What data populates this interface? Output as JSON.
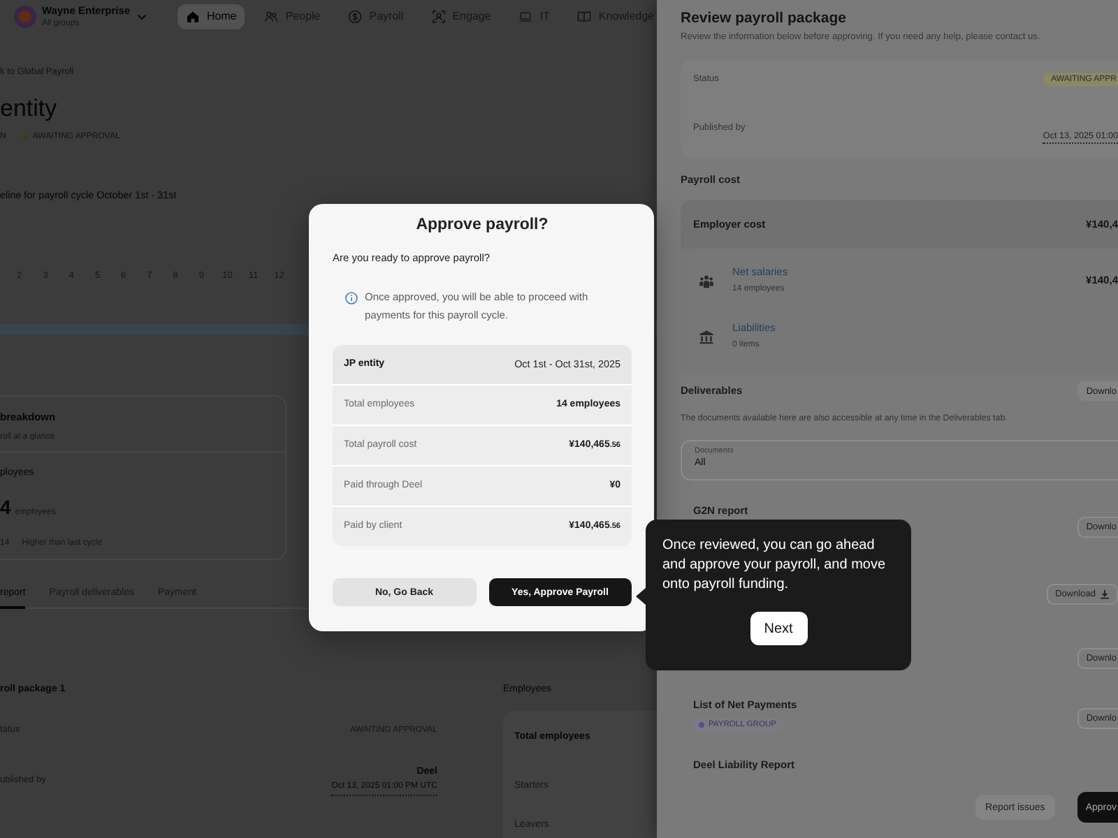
{
  "background_page": {
    "organization": {
      "name": "Wayne Enterprise",
      "subtitle": "All groups"
    },
    "nav": [
      {
        "label": "Home",
        "selected": true
      },
      {
        "label": "People",
        "selected": false
      },
      {
        "label": "Payroll",
        "selected": false
      },
      {
        "label": "Engage",
        "selected": false
      },
      {
        "label": "IT",
        "selected": false
      },
      {
        "label": "Knowledge",
        "selected": false
      }
    ],
    "breadcrumb": "k to Global Payroll",
    "title": "entity",
    "title_meta": "N",
    "status": "AWAITING APPROVAL",
    "timeline": {
      "title": "eline for payroll cycle October 1st - 31st",
      "days": [
        "2",
        "3",
        "4",
        "5",
        "6",
        "7",
        "8",
        "9",
        "10",
        "11",
        "12"
      ]
    },
    "breakdown": {
      "title": "breakdown",
      "subtitle": "roll at a glance",
      "metric_label": "ployees",
      "metric_value": "4",
      "metric_unit": "employees",
      "change_value": "14",
      "change_text": "Higher than last cycle"
    },
    "tabs": [
      {
        "label": "report",
        "selected": true
      },
      {
        "label": "Payroll deliverables",
        "selected": false
      },
      {
        "label": "Payment",
        "selected": false
      }
    ],
    "package": {
      "title": "roll package 1",
      "fields": [
        {
          "kind": "status",
          "label": "tatus",
          "value": "AWAITING APPROVAL"
        },
        {
          "kind": "publisher",
          "label": "ublished by",
          "name": "Deel",
          "date": "Oct 13, 2025 01:00 PM UTC"
        }
      ]
    },
    "employees": {
      "title": "Employees",
      "rows": [
        "Total employees",
        "Starters",
        "Leavers"
      ]
    }
  },
  "drawer": {
    "title": "Review payroll package",
    "subtitle": "Review the information below before approving. If you need any help, please contact us.",
    "summary": [
      {
        "kind": "status",
        "label": "Status",
        "value": "AWAITING APPR"
      },
      {
        "kind": "date",
        "label": "Published by",
        "value": "Oct 13, 2025 01:00"
      }
    ],
    "payroll_cost": {
      "title": "Payroll cost",
      "total": {
        "label": "Employer cost",
        "value": "¥140,4"
      },
      "items": [
        {
          "label": "Net salaries",
          "detail": "14 employees",
          "value": "¥140,4"
        },
        {
          "label": "Liabilities",
          "detail": "0 items"
        }
      ]
    },
    "deliverables": {
      "title": "Deliverables",
      "download_all": "Downlo",
      "caption": "The documents available here are also accessible at any time in the Deliverables tab.",
      "filter": {
        "label": "Documents",
        "value": "All"
      },
      "items": [
        {
          "name": "G2N report",
          "button": "Downlo",
          "with_icon": false
        },
        {
          "button": "Download",
          "with_icon": true
        },
        {
          "button": "Downlo",
          "with_icon": false
        },
        {
          "name": "List of Net Payments",
          "tag": "PAYROLL GROUP",
          "button": "Downlo",
          "with_icon": false
        },
        {
          "name": "Deel Liability Report"
        }
      ]
    },
    "footer": {
      "buttons": [
        {
          "label": "Report issues",
          "kind": "secondary"
        },
        {
          "label": "Approv",
          "kind": "primary"
        }
      ]
    }
  },
  "modal": {
    "title": "Approve payroll?",
    "question": "Are you ready to approve payroll?",
    "info": "Once approved, you will be able to proceed with payments for this payroll cycle.",
    "summary": {
      "header": {
        "label": "JP entity",
        "value": "Oct 1st - Oct 31st, 2025"
      },
      "rows": [
        {
          "label": "Total employees",
          "value": "14 employees"
        },
        {
          "label": "Total payroll cost",
          "value": "¥140,465",
          "minor": ".56"
        },
        {
          "label": "Paid through Deel",
          "value": "¥0"
        },
        {
          "label": "Paid by client",
          "value": "¥140,465",
          "minor": ".56"
        }
      ]
    },
    "buttons": [
      {
        "label": "No, Go Back",
        "kind": "secondary"
      },
      {
        "label": "Yes, Approve Payroll",
        "kind": "primary"
      }
    ]
  },
  "tooltip": {
    "text": "Once reviewed, you can go ahead and approve your payroll, and move onto payroll funding.",
    "button": "Next"
  }
}
